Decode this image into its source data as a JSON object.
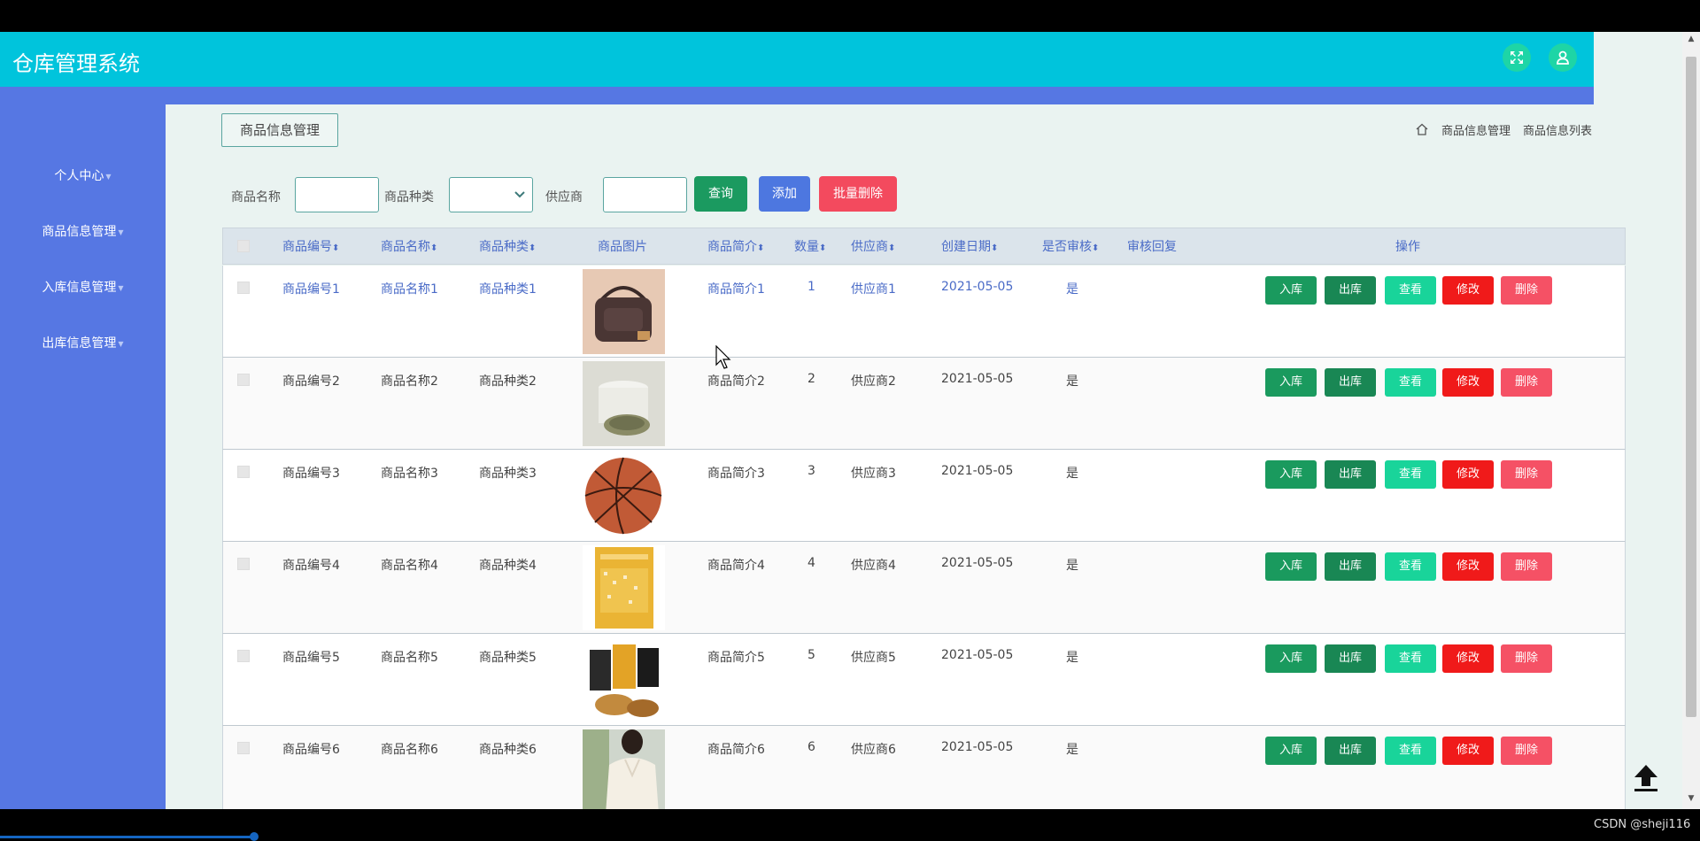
{
  "app": {
    "title": "仓库管理系统"
  },
  "sidebar": {
    "items": [
      {
        "label": "个人中心"
      },
      {
        "label": "商品信息管理"
      },
      {
        "label": "入库信息管理"
      },
      {
        "label": "出库信息管理"
      }
    ]
  },
  "tab": {
    "label": "商品信息管理"
  },
  "breadcrumb": {
    "items": [
      "商品信息管理",
      "商品信息列表"
    ]
  },
  "search": {
    "name_label": "商品名称",
    "category_label": "商品种类",
    "supplier_label": "供应商",
    "name_value": "",
    "category_value": "",
    "supplier_value": "",
    "query_label": "查询",
    "add_label": "添加",
    "batch_delete_label": "批量删除"
  },
  "table": {
    "headers": {
      "code": "商品编号",
      "name": "商品名称",
      "category": "商品种类",
      "image": "商品图片",
      "intro": "商品简介",
      "qty": "数量",
      "supplier": "供应商",
      "date": "创建日期",
      "audited": "是否审核",
      "reply": "审核回复",
      "ops": "操作"
    },
    "sort_glyph": "⬍",
    "rows": [
      {
        "code": "商品编号1",
        "name": "商品名称1",
        "category": "商品种类1",
        "intro": "商品简介1",
        "qty": "1",
        "supplier": "供应商1",
        "date": "2021-05-05",
        "audited": "是",
        "reply": "",
        "image": "handbag",
        "highlight": true
      },
      {
        "code": "商品编号2",
        "name": "商品名称2",
        "category": "商品种类2",
        "intro": "商品简介2",
        "qty": "2",
        "supplier": "供应商2",
        "date": "2021-05-05",
        "audited": "是",
        "reply": "",
        "image": "cup",
        "highlight": false
      },
      {
        "code": "商品编号3",
        "name": "商品名称3",
        "category": "商品种类3",
        "intro": "商品简介3",
        "qty": "3",
        "supplier": "供应商3",
        "date": "2021-05-05",
        "audited": "是",
        "reply": "",
        "image": "basketball",
        "highlight": false
      },
      {
        "code": "商品编号4",
        "name": "商品名称4",
        "category": "商品种类4",
        "intro": "商品简介4",
        "qty": "4",
        "supplier": "供应商4",
        "date": "2021-05-05",
        "audited": "是",
        "reply": "",
        "image": "book",
        "highlight": false
      },
      {
        "code": "商品编号5",
        "name": "商品名称5",
        "category": "商品种类5",
        "intro": "商品简介5",
        "qty": "5",
        "supplier": "供应商5",
        "date": "2021-05-05",
        "audited": "是",
        "reply": "",
        "image": "snacks",
        "highlight": false
      },
      {
        "code": "商品编号6",
        "name": "商品名称6",
        "category": "商品种类6",
        "intro": "商品简介6",
        "qty": "6",
        "supplier": "供应商6",
        "date": "2021-05-05",
        "audited": "是",
        "reply": "",
        "image": "blouse",
        "highlight": false
      }
    ],
    "actions": [
      {
        "label": "入库",
        "color": "#1a9a5e"
      },
      {
        "label": "出库",
        "color": "#198754"
      },
      {
        "label": "查看",
        "color": "#19d49a"
      },
      {
        "label": "修改",
        "color": "#f01a1a"
      },
      {
        "label": "删除",
        "color": "#f55165"
      }
    ]
  },
  "colors": {
    "header": "#00c4dc",
    "sidebar": "#5677e3",
    "link_blue": "#4a6bc7",
    "text_dark": "#444444"
  },
  "icons": {
    "fullscreen": "expand-arrows-icon",
    "user": "user-icon",
    "home": "home-icon",
    "back_to_top": "arrow-up-icon"
  },
  "watermark": "CSDN @sheji116"
}
